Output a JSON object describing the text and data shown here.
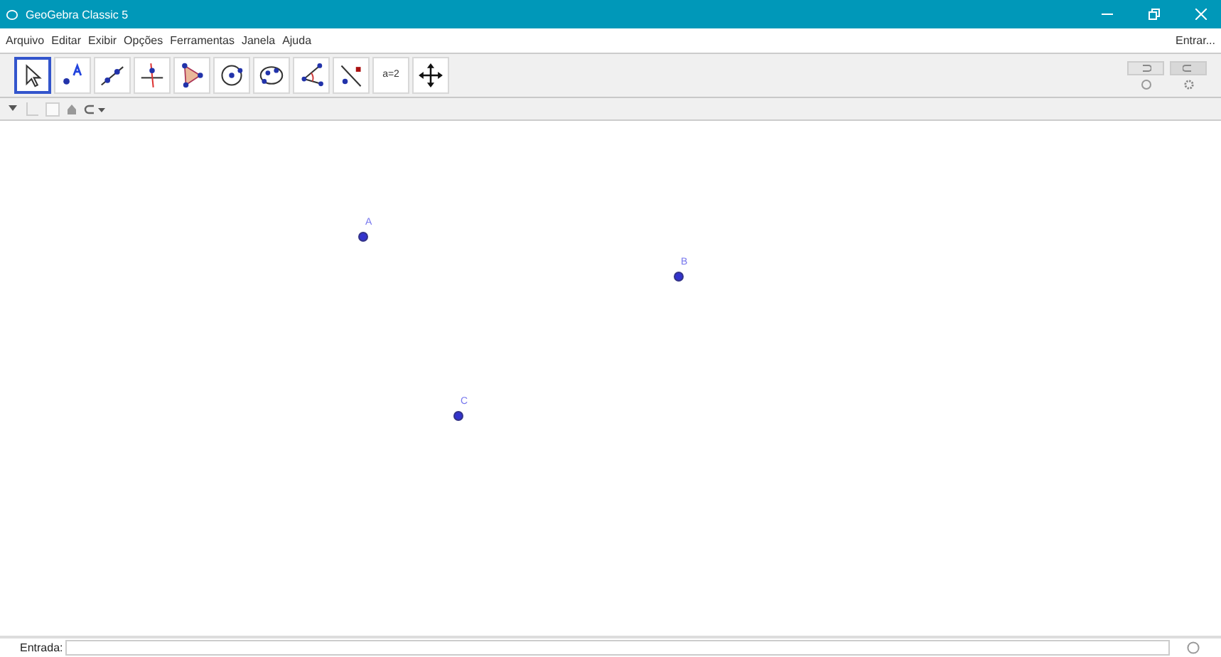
{
  "window": {
    "title": "GeoGebra Classic 5"
  },
  "menu": [
    "Arquivo",
    "Editar",
    "Exibir",
    "Opções",
    "Ferramentas",
    "Janela",
    "Ajuda"
  ],
  "sign_in": "Entrar...",
  "tools": [
    {
      "kind": "move",
      "selected": true
    },
    {
      "kind": "point",
      "selected": false
    },
    {
      "kind": "line",
      "selected": false
    },
    {
      "kind": "perpendicular",
      "selected": false
    },
    {
      "kind": "polygon",
      "selected": false
    },
    {
      "kind": "circle",
      "selected": false
    },
    {
      "kind": "ellipse",
      "selected": false
    },
    {
      "kind": "angle",
      "selected": false
    },
    {
      "kind": "reflect",
      "selected": false
    },
    {
      "kind": "slider",
      "selected": false
    },
    {
      "kind": "pan",
      "selected": false
    }
  ],
  "slider_tool_text": "a=2",
  "points": [
    {
      "label": "A"
    },
    {
      "label": "B"
    },
    {
      "label": "C"
    }
  ],
  "input_bar": {
    "label": "Entrada:"
  }
}
